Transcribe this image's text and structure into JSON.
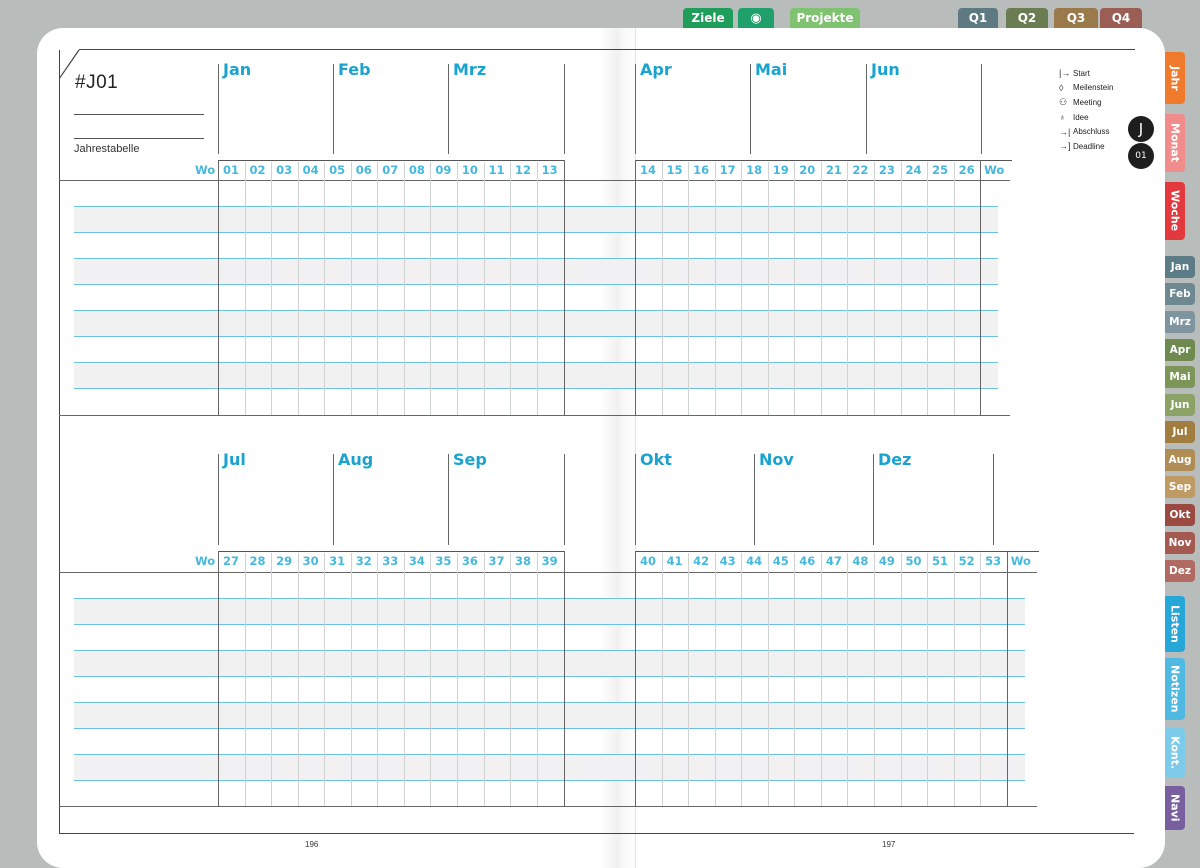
{
  "top_tabs": [
    {
      "label": "Ziele",
      "color": "#1f9d5b",
      "name": "tab-ziele"
    },
    {
      "label": "",
      "icon": "eye-icon",
      "color": "#1fa06a",
      "name": "tab-overview"
    },
    {
      "label": "Projekte",
      "color": "#7fc26f",
      "name": "tab-projekte"
    },
    {
      "label": "Q1",
      "color": "#5d7a82",
      "name": "tab-q1"
    },
    {
      "label": "Q2",
      "color": "#6a7d52",
      "name": "tab-q2"
    },
    {
      "label": "Q3",
      "color": "#9a7a4a",
      "name": "tab-q3"
    },
    {
      "label": "Q4",
      "color": "#9a5e55",
      "name": "tab-q4"
    }
  ],
  "side_tabs": [
    {
      "label": "Jahr",
      "color": "#ef7a2b"
    },
    {
      "label": "Monat",
      "color": "#f08c8c"
    },
    {
      "label": "Woche",
      "color": "#e2393f"
    },
    {
      "label": "Jan",
      "color": "#5b7b86"
    },
    {
      "label": "Feb",
      "color": "#6d8890"
    },
    {
      "label": "Mrz",
      "color": "#7e95a0"
    },
    {
      "label": "Apr",
      "color": "#6e8a4f"
    },
    {
      "label": "Mai",
      "color": "#7c9657"
    },
    {
      "label": "Jun",
      "color": "#8aa265"
    },
    {
      "label": "Jul",
      "color": "#a17e3f"
    },
    {
      "label": "Aug",
      "color": "#b08c55"
    },
    {
      "label": "Sep",
      "color": "#bf9a63"
    },
    {
      "label": "Okt",
      "color": "#9a4a40"
    },
    {
      "label": "Nov",
      "color": "#a45a50"
    },
    {
      "label": "Dez",
      "color": "#b06a61"
    },
    {
      "label": "Listen",
      "color": "#27a6d8"
    },
    {
      "label": "Notizen",
      "color": "#4fb9e2"
    },
    {
      "label": "Kont.",
      "color": "#7ccbea"
    },
    {
      "label": "Navi",
      "color": "#7a5fa0"
    }
  ],
  "header": {
    "id": "#J01",
    "subtitle": "Jahrestabelle"
  },
  "badges": {
    "letter": "J",
    "number": "01"
  },
  "legend": [
    {
      "icon": "start-icon",
      "glyph": "|→",
      "label": "Start"
    },
    {
      "icon": "milestone-icon",
      "glyph": "◊",
      "label": "Meilenstein"
    },
    {
      "icon": "meeting-icon",
      "glyph": "⚇",
      "label": "Meeting"
    },
    {
      "icon": "idea-icon",
      "glyph": "♁",
      "label": "Idee"
    },
    {
      "icon": "completion-icon",
      "glyph": "→|",
      "label": "Abschluss"
    },
    {
      "icon": "deadline-icon",
      "glyph": "→]",
      "label": "Deadline"
    }
  ],
  "half1": {
    "months_left": [
      "Jan",
      "Feb",
      "Mrz"
    ],
    "months_right": [
      "Apr",
      "Mai",
      "Jun"
    ],
    "weeks_left": [
      "01",
      "02",
      "03",
      "04",
      "05",
      "06",
      "07",
      "08",
      "09",
      "10",
      "11",
      "12",
      "13"
    ],
    "weeks_right": [
      "14",
      "15",
      "16",
      "17",
      "18",
      "19",
      "20",
      "21",
      "22",
      "23",
      "24",
      "25",
      "26"
    ],
    "wo": "Wo"
  },
  "half2": {
    "months_left": [
      "Jul",
      "Aug",
      "Sep"
    ],
    "months_right": [
      "Okt",
      "Nov",
      "Dez"
    ],
    "weeks_left": [
      "27",
      "28",
      "29",
      "30",
      "31",
      "32",
      "33",
      "34",
      "35",
      "36",
      "37",
      "38",
      "39"
    ],
    "weeks_right": [
      "40",
      "41",
      "42",
      "43",
      "44",
      "45",
      "46",
      "47",
      "48",
      "49",
      "50",
      "51",
      "52",
      "53"
    ],
    "wo": "Wo"
  },
  "page_numbers": {
    "left": "196",
    "right": "197"
  }
}
